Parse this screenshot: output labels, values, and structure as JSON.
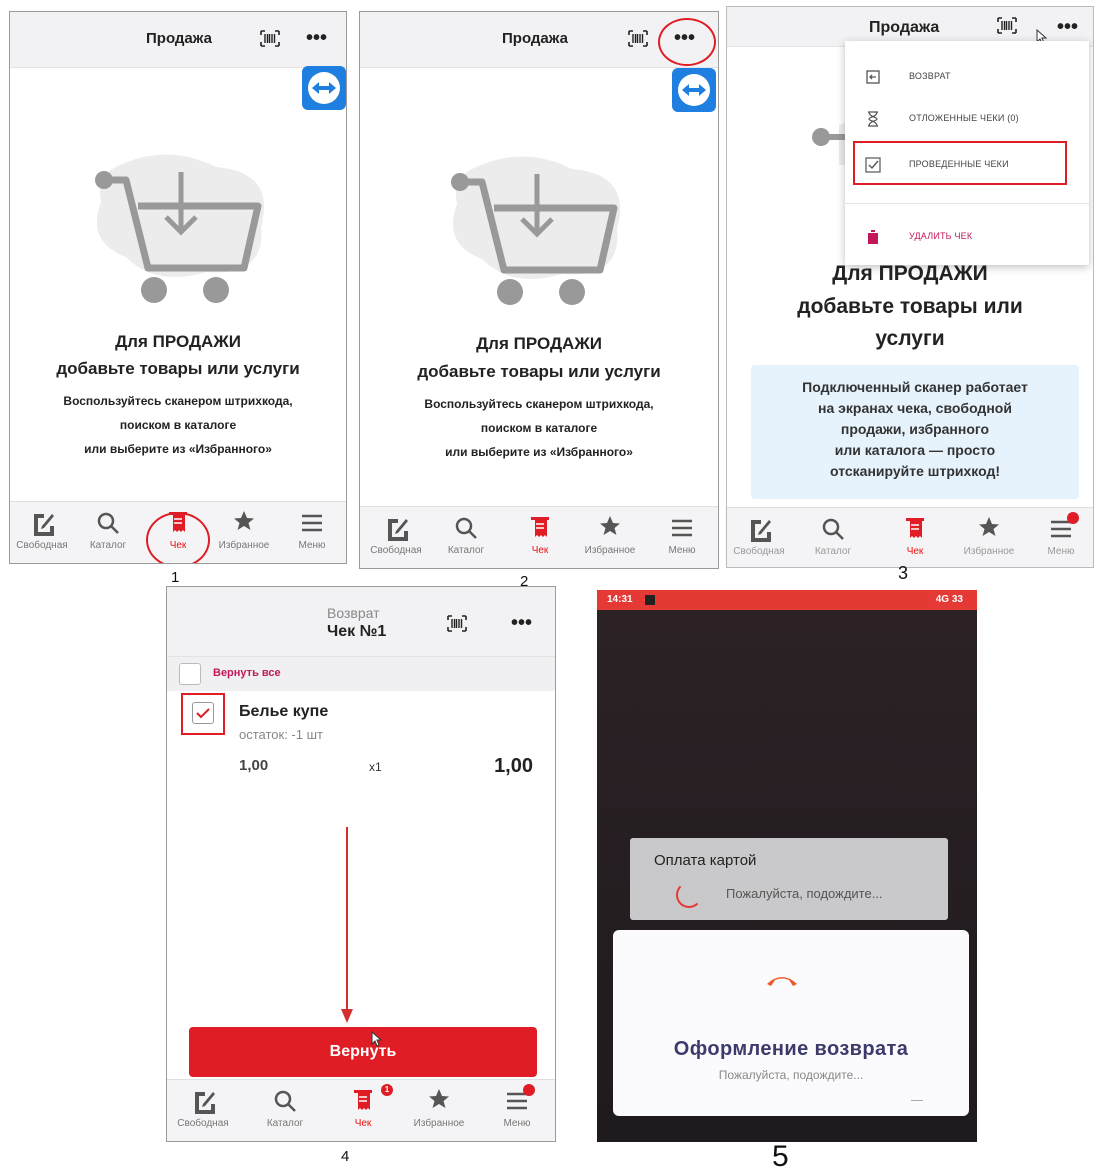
{
  "common": {
    "header_title": "Продажа",
    "empty_title_1": "Для ПРОДАЖИ",
    "empty_title_2": "добавьте товары или услуги",
    "empty_sub_1": "Воспользуйтесь сканером штрихкода,",
    "empty_sub_2": "поиском в каталоге",
    "empty_sub_3": "или выберите из «Избранного»",
    "nav": {
      "free": "Свободная",
      "catalog": "Каталог",
      "check": "Чек",
      "favorites": "Избранное",
      "menu": "Меню"
    },
    "accent": "#e01c24"
  },
  "panel1": {
    "label": "1"
  },
  "panel2": {
    "label": "2"
  },
  "panel3": {
    "label": "3",
    "empty_title_1": "Для ПРОДАЖИ",
    "empty_title_2": "добавьте товары или",
    "empty_title_3": "услуги",
    "menu": [
      {
        "label": "ВОЗВРАТ",
        "icon": "return-icon"
      },
      {
        "label": "ОТЛОЖЕННЫЕ ЧЕКИ (0)",
        "icon": "hourglass-icon"
      },
      {
        "label": "ПРОВЕДЕННЫЕ ЧЕКИ",
        "icon": "checked-list-icon"
      },
      {
        "label": "УДАЛИТЬ ЧЕК",
        "icon": "trash-icon"
      }
    ],
    "info": [
      "Подключенный сканер работает",
      "на экранах чека, свободной",
      "продажи, избранного",
      "или каталога — просто",
      "отсканируйте штрихкод!"
    ]
  },
  "panel4": {
    "label": "4",
    "header_sub": "Возврат",
    "header_title": "Чек №1",
    "return_all": "Вернуть все",
    "item": {
      "name": "Белье купе",
      "rest": "остаток: -1 шт",
      "price": "1,00",
      "qty": "x1",
      "total": "1,00"
    },
    "return_button": "Вернуть",
    "check_badge": "1"
  },
  "panel5": {
    "label": "5",
    "time": "14:31",
    "status_right": "4G 33",
    "pay_title": "Оплата картой",
    "pay_wait": "Пожалуйста, подождите...",
    "ret_title": "Оформление возврата",
    "ret_wait": "Пожалуйста, подождите..."
  }
}
